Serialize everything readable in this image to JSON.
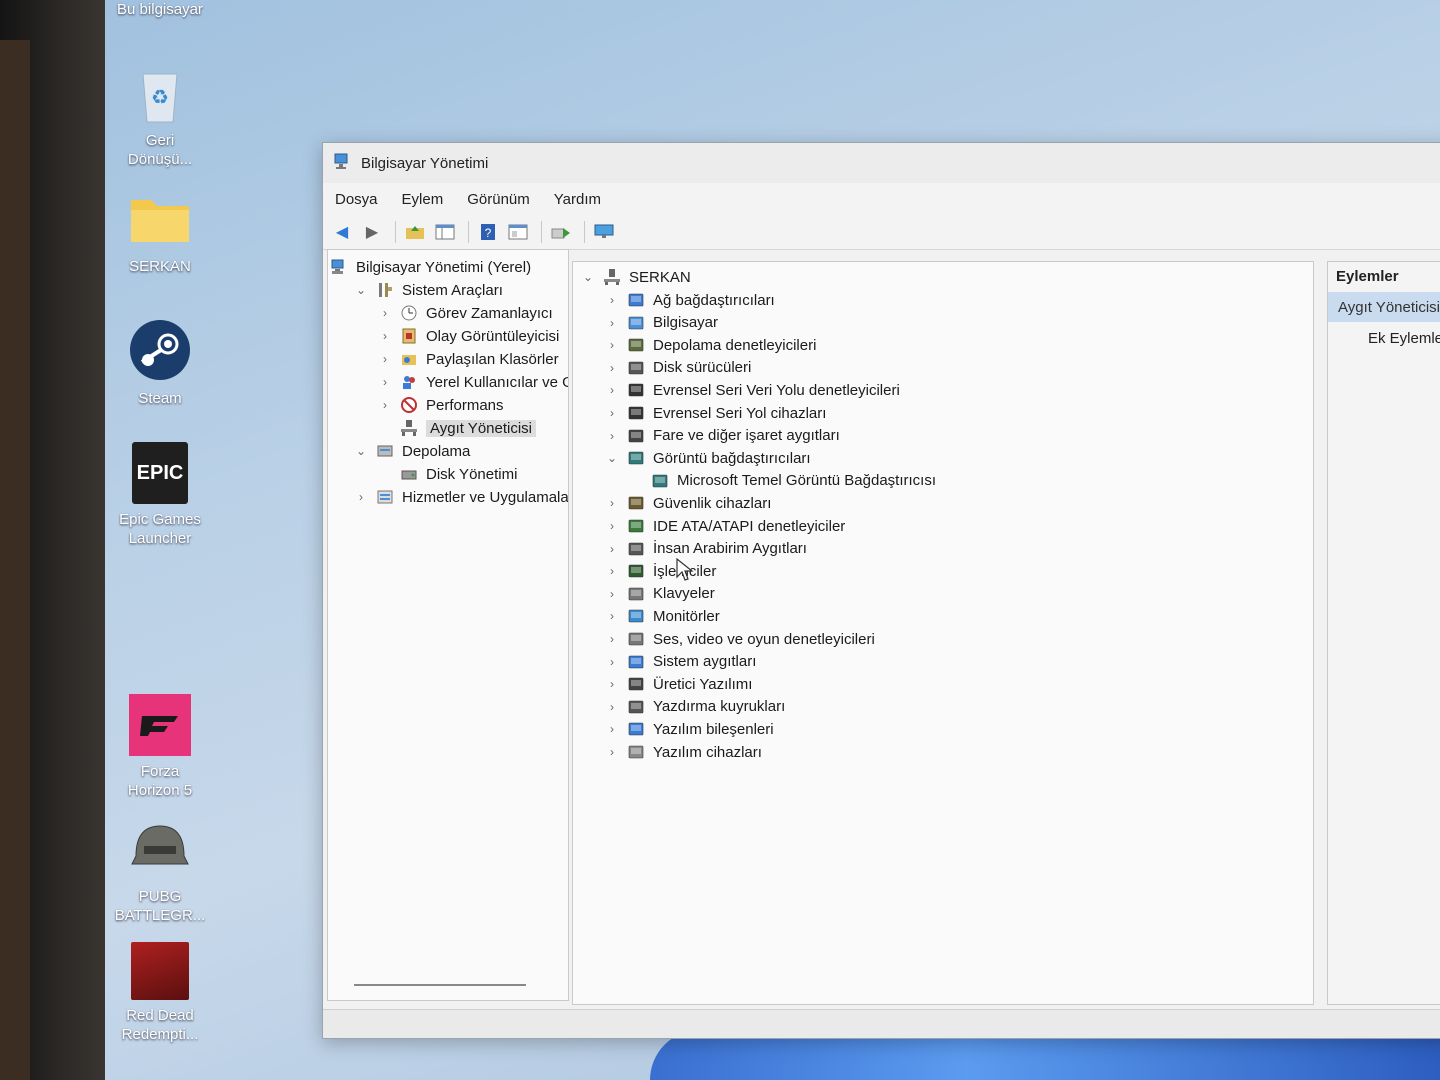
{
  "desktop": {
    "top_label": "Bu bilgisayar",
    "icons": [
      {
        "label_lines": [
          "Geri",
          "Dönüşü..."
        ],
        "icon": "recycle-bin-icon"
      },
      {
        "label_lines": [
          "SERKAN"
        ],
        "icon": "folder-icon"
      },
      {
        "label_lines": [
          "Steam"
        ],
        "icon": "steam-icon"
      },
      {
        "label_lines": [
          "Epic Games",
          "Launcher"
        ],
        "icon": "epic-games-icon",
        "logo_text": "EPIC"
      },
      {
        "label_lines": [
          "Forza",
          "Horizon 5"
        ],
        "icon": "forza-icon"
      },
      {
        "label_lines": [
          "PUBG",
          "BATTLEGR..."
        ],
        "icon": "pubg-icon"
      },
      {
        "label_lines": [
          "Red Dead",
          "Redempti..."
        ],
        "icon": "red-dead-icon"
      }
    ]
  },
  "window": {
    "title": "Bilgisayar Yönetimi",
    "menu": [
      "Dosya",
      "Eylem",
      "Görünüm",
      "Yardım"
    ],
    "toolbar_icons": [
      "back-arrow-icon",
      "forward-arrow-icon",
      "up-folder-icon",
      "show-hide-console-tree-icon",
      "help-icon",
      "properties-icon",
      "export-icon",
      "monitor-icon"
    ]
  },
  "left_tree": [
    {
      "label": "Bilgisayar Yönetimi (Yerel)",
      "level": 0,
      "chevron": "",
      "icon": "computer-management-icon"
    },
    {
      "label": "Sistem Araçları",
      "level": 1,
      "chevron": "open",
      "icon": "tools-icon"
    },
    {
      "label": "Görev Zamanlayıcı",
      "level": 2,
      "chevron": "closed",
      "icon": "clock-icon"
    },
    {
      "label": "Olay Görüntüleyicisi",
      "level": 2,
      "chevron": "closed",
      "icon": "event-viewer-icon"
    },
    {
      "label": "Paylaşılan Klasörler",
      "level": 2,
      "chevron": "closed",
      "icon": "shared-folder-icon"
    },
    {
      "label": "Yerel Kullanıcılar ve Gru",
      "level": 2,
      "chevron": "closed",
      "icon": "users-icon"
    },
    {
      "label": "Performans",
      "level": 2,
      "chevron": "closed",
      "icon": "performance-icon"
    },
    {
      "label": "Aygıt Yöneticisi",
      "level": 2,
      "chevron": "",
      "icon": "device-manager-icon",
      "selected": true
    },
    {
      "label": "Depolama",
      "level": 1,
      "chevron": "open",
      "icon": "storage-icon"
    },
    {
      "label": "Disk Yönetimi",
      "level": 2,
      "chevron": "",
      "icon": "disk-management-icon"
    },
    {
      "label": "Hizmetler ve Uygulamalar",
      "level": 1,
      "chevron": "closed",
      "icon": "services-icon"
    }
  ],
  "device_tree": {
    "root": "SERKAN",
    "items": [
      {
        "label": "Ağ bağdaştırıcıları",
        "level": 1,
        "chevron": "closed",
        "icon": "network-adapter-icon",
        "color": "#3a7bd5"
      },
      {
        "label": "Bilgisayar",
        "level": 1,
        "chevron": "closed",
        "icon": "computer-icon",
        "color": "#4a90d9"
      },
      {
        "label": "Depolama denetleyicileri",
        "level": 1,
        "chevron": "closed",
        "icon": "storage-controller-icon",
        "color": "#5a6b3a"
      },
      {
        "label": "Disk sürücüleri",
        "level": 1,
        "chevron": "closed",
        "icon": "disk-drive-icon",
        "color": "#555555"
      },
      {
        "label": "Evrensel Seri Veri Yolu denetleyicileri",
        "level": 1,
        "chevron": "closed",
        "icon": "usb-controller-icon",
        "color": "#333333"
      },
      {
        "label": "Evrensel Seri Yol cihazları",
        "level": 1,
        "chevron": "closed",
        "icon": "usb-device-icon",
        "color": "#333333"
      },
      {
        "label": "Fare ve diğer işaret aygıtları",
        "level": 1,
        "chevron": "closed",
        "icon": "mouse-icon",
        "color": "#444444"
      },
      {
        "label": "Görüntü bağdaştırıcıları",
        "level": 1,
        "chevron": "open",
        "icon": "display-adapter-icon",
        "color": "#2f7a7a"
      },
      {
        "label": "Microsoft Temel Görüntü Bağdaştırıcısı",
        "level": 2,
        "chevron": "",
        "icon": "display-adapter-icon",
        "color": "#2f7a7a"
      },
      {
        "label": "Güvenlik cihazları",
        "level": 1,
        "chevron": "closed",
        "icon": "security-device-icon",
        "color": "#6b5a2a"
      },
      {
        "label": "IDE ATA/ATAPI denetleyiciler",
        "level": 1,
        "chevron": "closed",
        "icon": "ide-controller-icon",
        "color": "#3a7a3a"
      },
      {
        "label": "İnsan Arabirim Aygıtları",
        "level": 1,
        "chevron": "closed",
        "icon": "hid-icon",
        "color": "#555555"
      },
      {
        "label": "İşlemciler",
        "level": 1,
        "chevron": "closed",
        "icon": "processor-icon",
        "color": "#2e5a2e"
      },
      {
        "label": "Klavyeler",
        "level": 1,
        "chevron": "closed",
        "icon": "keyboard-icon",
        "color": "#777777"
      },
      {
        "label": "Monitörler",
        "level": 1,
        "chevron": "closed",
        "icon": "monitor-icon",
        "color": "#3a8ad0"
      },
      {
        "label": "Ses, video ve oyun denetleyicileri",
        "level": 1,
        "chevron": "closed",
        "icon": "audio-icon",
        "color": "#777777"
      },
      {
        "label": "Sistem aygıtları",
        "level": 1,
        "chevron": "closed",
        "icon": "system-device-icon",
        "color": "#3a7bd5"
      },
      {
        "label": "Üretici Yazılımı",
        "level": 1,
        "chevron": "closed",
        "icon": "firmware-icon",
        "color": "#444444"
      },
      {
        "label": "Yazdırma kuyrukları",
        "level": 1,
        "chevron": "closed",
        "icon": "print-queue-icon",
        "color": "#555555"
      },
      {
        "label": "Yazılım bileşenleri",
        "level": 1,
        "chevron": "closed",
        "icon": "software-component-icon",
        "color": "#3a7bd5"
      },
      {
        "label": "Yazılım cihazları",
        "level": 1,
        "chevron": "closed",
        "icon": "software-device-icon",
        "color": "#888888"
      }
    ]
  },
  "actions": {
    "header": "Eylemler",
    "selected": "Aygıt Yöneticisi",
    "more": "Ek Eylemler"
  }
}
